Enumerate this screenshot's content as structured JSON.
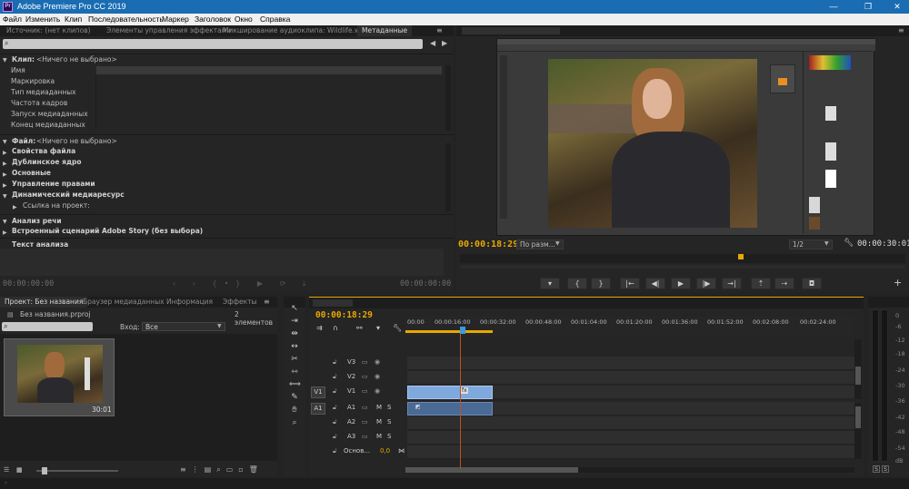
{
  "window": {
    "title": "Adobe Premiere Pro CC 2019",
    "logo": "Pr",
    "minimize": "—",
    "restore": "❐",
    "close": "✕"
  },
  "menu": [
    "Файл",
    "Изменить",
    "Клип",
    "Последовательность",
    "Маркер",
    "Заголовок",
    "Окно",
    "Справка"
  ],
  "source_panel": {
    "tabs": [
      "Источник: (нет клипов)",
      "Элементы управления эффектами",
      "Микширование аудиоклипа: Wildlife.wmv",
      "Метаданные"
    ],
    "search_placeholder": "",
    "clip_header": "Клип:",
    "clip_value": "<Ничего не выбрано>",
    "clip_fields": [
      "Имя",
      "Маркировка",
      "Тип медиаданных",
      "Частота кадров",
      "Запуск медиаданных",
      "Конец медиаданных"
    ],
    "file_header": "Файл:",
    "file_value": "<Ничего не выбрано>",
    "file_sections": [
      "Свойства файла",
      "Дублинское ядро",
      "Основные",
      "Управление правами",
      "Динамический медиаресурс"
    ],
    "project_link": "Ссылка на проект:",
    "speech_header": "Анализ речи",
    "story_script": "Встроенный сценарий Adobe Story (без выбора)",
    "text_analysis": "Текст анализа",
    "timecode_left": "00:00:00:00",
    "timecode_right": "00:00:00:00"
  },
  "program_monitor": {
    "timecode": "00:00:18:29",
    "fit": "По разм...",
    "resolution": "1/2",
    "duration": "00:00:30:01"
  },
  "project_panel": {
    "tabs": [
      "Проект: Без названия",
      "Браузер медиаданных",
      "Информация",
      "Эффекты"
    ],
    "file_name": "Без названия.prproj",
    "item_count": "2 элементов",
    "search_placeholder": "",
    "input_label": "Вход:",
    "input_value": "Все",
    "clip_duration": "30:01"
  },
  "timeline": {
    "timecode": "00:00:18:29",
    "ruler": [
      "00:00",
      "00:00:16:00",
      "00:00:32:00",
      "00:00:48:00",
      "00:01:04:00",
      "00:01:20:00",
      "00:01:36:00",
      "00:01:52:00",
      "00:02:08:00",
      "00:02:24:00"
    ],
    "video_tracks": [
      "V3",
      "V2",
      "V1"
    ],
    "audio_tracks": [
      "A1",
      "A2",
      "A3"
    ],
    "source_v": "V1",
    "source_a": "A1",
    "master_label": "Основ...",
    "master_value": "0,0",
    "mute": "M",
    "solo": "S",
    "clip_badge": "fx"
  },
  "audio_meter": {
    "labels": [
      "0",
      "-6",
      "-12",
      "-18",
      "-24",
      "-30",
      "-36",
      "-42",
      "-48",
      "-54",
      "dB"
    ],
    "solo_left": "S",
    "solo_right": "S"
  },
  "colors": {
    "accent_blue": "#1a6db3",
    "timecode_orange": "#e8a800",
    "timecode_blue": "#3b9ae8",
    "video_clip": "#7fa8dc",
    "audio_clip": "#4a6a96",
    "playhead": "#c0501f"
  }
}
